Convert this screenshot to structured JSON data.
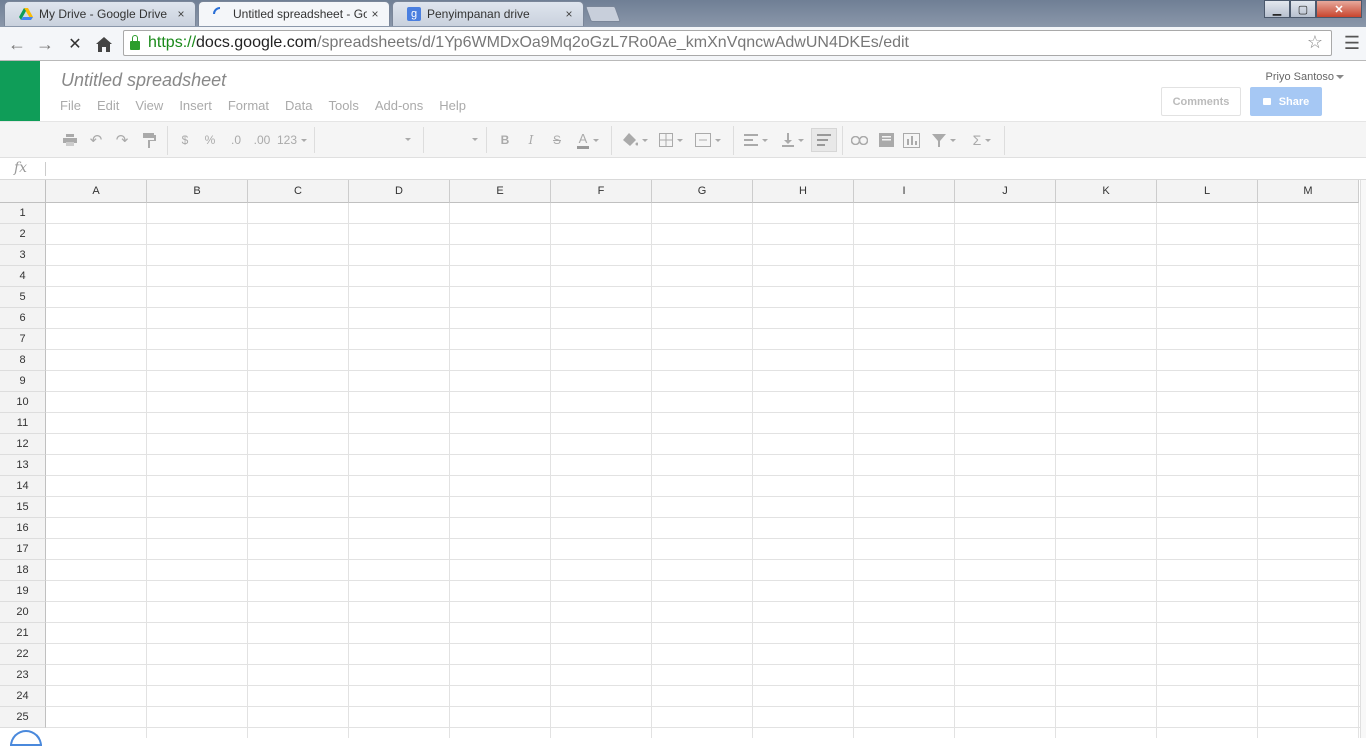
{
  "browser": {
    "tabs": [
      {
        "title": "My Drive - Google Drive",
        "close": "×"
      },
      {
        "title": "Untitled spreadsheet - Goo",
        "close": "×"
      },
      {
        "title": "Penyimpanan drive",
        "close": "×"
      }
    ],
    "url": {
      "https": "https://",
      "host": "docs.google.com",
      "path": "/spreadsheets/d/1Yp6WMDxOa9Mq2oGzL7Ro0Ae_kmXnVqncwAdwUN4DKEs/edit"
    },
    "window_controls": {
      "minimize": "▁",
      "maximize": "▢",
      "close": "✕"
    }
  },
  "doc": {
    "title": "Untitled spreadsheet",
    "menu": [
      "File",
      "Edit",
      "View",
      "Insert",
      "Format",
      "Data",
      "Tools",
      "Add-ons",
      "Help"
    ],
    "user": "Priyo Santoso",
    "comments_label": "Comments",
    "share_label": "Share"
  },
  "toolbar": {
    "currency": "$",
    "percent": "%",
    "dec_less": ".0",
    "dec_more": ".00",
    "number_format": "123",
    "bold": "B",
    "italic": "I",
    "strike": "S",
    "text_color": "A",
    "sum": "Σ"
  },
  "formula_bar": {
    "fx": "fx"
  },
  "grid": {
    "columns": [
      "A",
      "B",
      "C",
      "D",
      "E",
      "F",
      "G",
      "H",
      "I",
      "J",
      "K",
      "L",
      "M"
    ],
    "rows": [
      "1",
      "2",
      "3",
      "4",
      "5",
      "6",
      "7",
      "8",
      "9",
      "10",
      "11",
      "12",
      "13",
      "14",
      "15",
      "16",
      "17",
      "18",
      "19",
      "20",
      "21",
      "22",
      "23",
      "24",
      "25"
    ]
  },
  "colors": {
    "docs_green": "#0f9d58",
    "share_blue": "#a6c8f4"
  }
}
